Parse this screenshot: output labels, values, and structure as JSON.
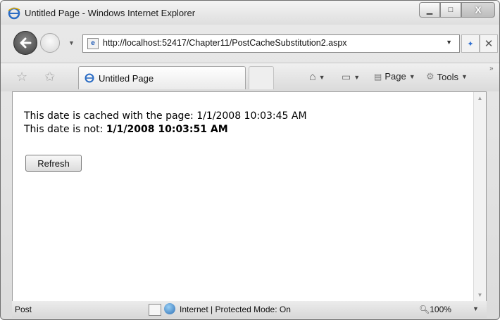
{
  "window": {
    "title": "Untitled Page - Windows Internet Explorer",
    "min_label": "▁",
    "max_label": "□",
    "close_label": "X"
  },
  "address": {
    "url": "http://localhost:52417/Chapter11/PostCacheSubstitution2.aspx"
  },
  "tab": {
    "label": "Untitled Page"
  },
  "commands": {
    "page_label": "Page",
    "tools_label": "Tools"
  },
  "content": {
    "line1": "This date is cached with the page: 1/1/2008 10:03:45 AM",
    "line2_prefix": "This date is not: ",
    "line2_value": "1/1/2008 10:03:51 AM",
    "refresh_label": "Refresh"
  },
  "status": {
    "left_text": "Post",
    "zone": "Internet | Protected Mode: On",
    "zoom": "100%"
  },
  "icons": [
    "ie-logo-icon",
    "back-arrow-icon",
    "forward-arrow-icon",
    "page-icon",
    "refresh-icon",
    "stop-icon",
    "favorites-star-icon",
    "add-favorites-icon",
    "home-icon",
    "print-icon",
    "page-menu-icon",
    "tools-gear-icon",
    "zone-icon",
    "globe-icon",
    "zoom-icon"
  ]
}
